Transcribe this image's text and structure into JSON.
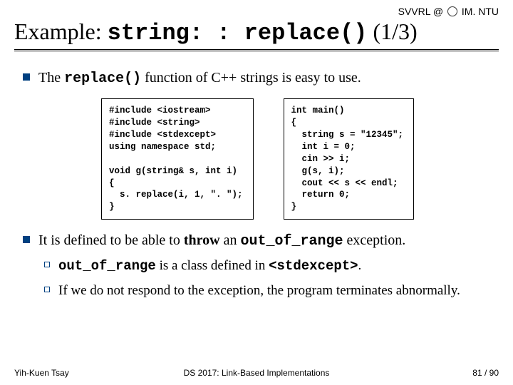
{
  "header": {
    "org_left": "SVVRL",
    "at": "@",
    "org_right": "IM. NTU"
  },
  "title": {
    "prefix": "Example: ",
    "code": "string: : replace()",
    "suffix": " (1/3)"
  },
  "bullet1": {
    "pre": "The ",
    "code": "replace()",
    "post": " function of C++ strings is easy to use."
  },
  "code_left": "#include <iostream>\n#include <string>\n#include <stdexcept>\nusing namespace std;\n\nvoid g(string& s, int i)\n{\n  s. replace(i, 1, \". \");\n}",
  "code_right": "int main()\n{\n  string s = \"12345\";\n  int i = 0;\n  cin >> i;\n  g(s, i);\n  cout << s << endl;\n  return 0;\n}",
  "bullet2": {
    "pre": "It is defined to be able to ",
    "bold": "throw",
    "post_pre": " an ",
    "code": "out_of_range",
    "post_after": " exception."
  },
  "sub1": {
    "code1": "out_of_range",
    "mid": " is a class defined in ",
    "code2": "<stdexcept>",
    "end": "."
  },
  "sub2": "If we do not respond to the exception, the program terminates abnormally.",
  "footer": {
    "left": "Yih-Kuen Tsay",
    "center": "DS 2017: Link-Based Implementations",
    "right": "81 / 90"
  }
}
